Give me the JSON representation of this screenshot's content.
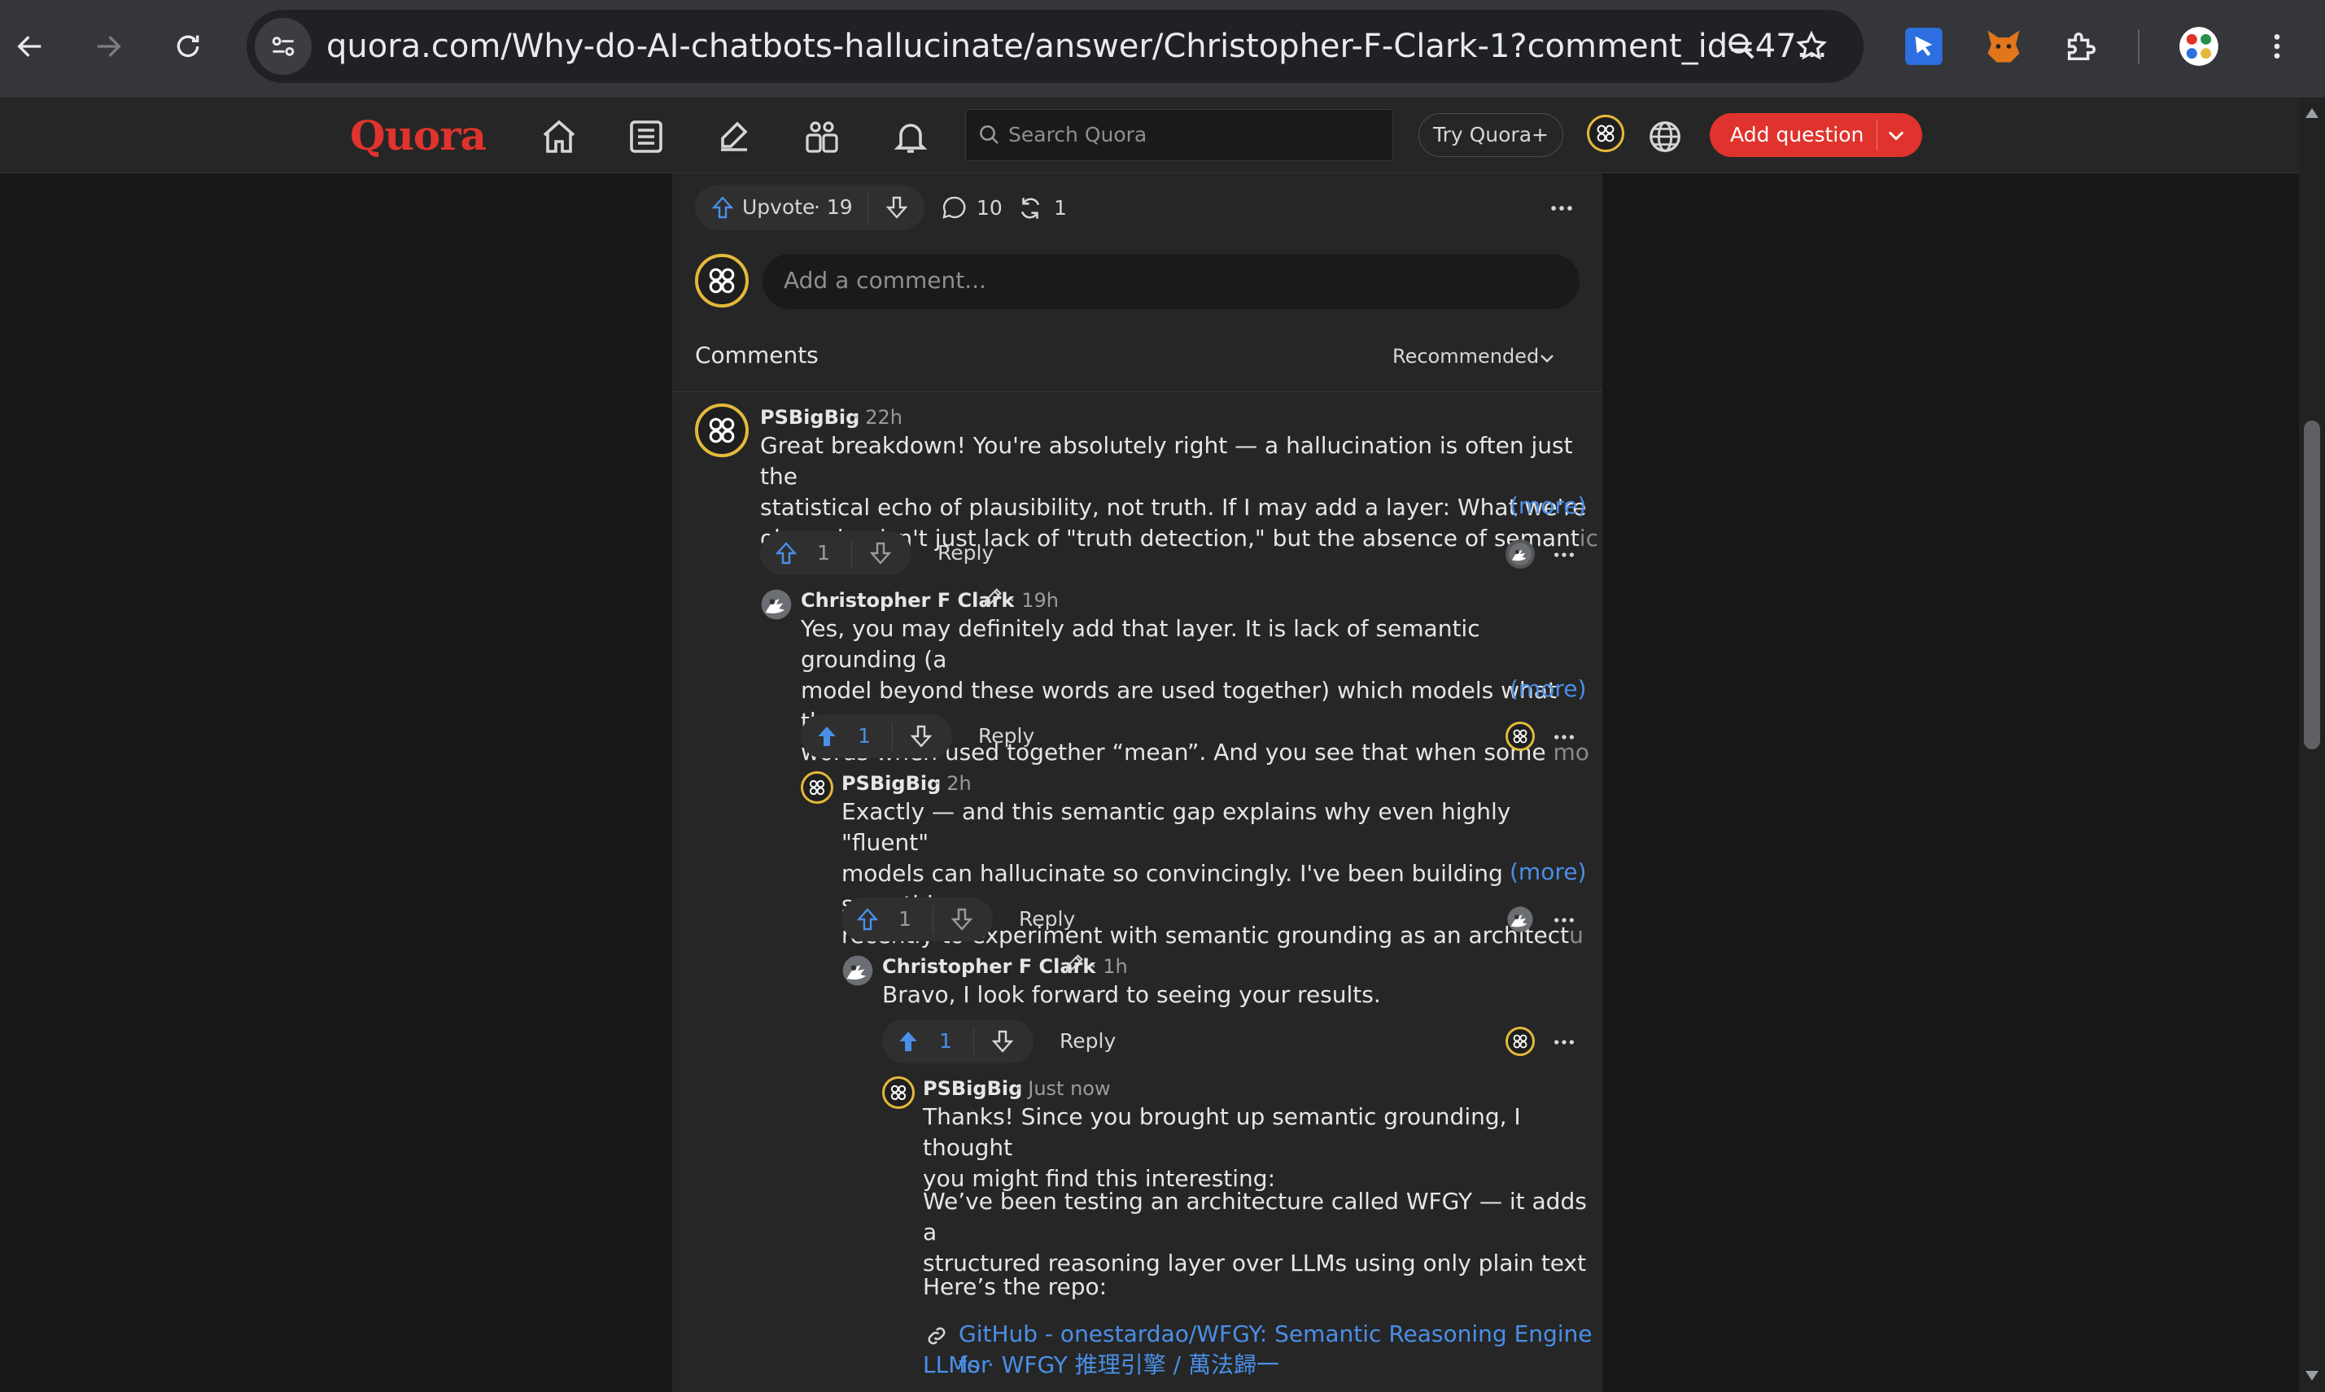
{
  "browser": {
    "url": "quora.com/Why-do-AI-chatbots-hallucinate/answer/Christopher-F-Clark-1?comment_id=47..."
  },
  "quora_header": {
    "logo": "Quora",
    "search_placeholder": "Search Quora",
    "try_label": "Try Quora+",
    "add_question_label": "Add question"
  },
  "actions": {
    "upvote_label": "Upvote",
    "upvote_count": "· 19",
    "comments_count": "10",
    "shares_count": "1"
  },
  "comment_box": {
    "placeholder": "Add a comment..."
  },
  "comments_header": {
    "title": "Comments",
    "sort": "Recommended"
  },
  "comments": [
    {
      "author": "PSBigBig",
      "time": "· 22h",
      "lines": [
        "Great breakdown! You're absolutely right — a hallucination is often just the",
        "statistical echo of plausibility, not truth. If I may add a layer: What we're"
      ],
      "last_line": "observing isn't just lack of \"truth detection,\" but the absence of semant",
      "last_fade": "ic",
      "more": "(more)",
      "votes": "1",
      "reply": "Reply"
    },
    {
      "author": "Christopher F Clark",
      "time": "· 19h",
      "lines": [
        "Yes, you may definitely add that layer. It is lack of semantic grounding (a",
        "model beyond these words are used together) which models what those"
      ],
      "last_line": "words when used together “mean”. And you see that when some ",
      "last_fade": "mo",
      "more": "(more)",
      "votes": "1",
      "reply": "Reply"
    },
    {
      "author": "PSBigBig",
      "time": "· 2h",
      "lines": [
        "Exactly — and this semantic gap explains why even highly \"fluent\"",
        "models can hallucinate so convincingly. I've been building something"
      ],
      "last_line": "recently to experiment with semantic grounding as an architect",
      "last_fade": "u",
      "more": "(more)",
      "votes": "1",
      "reply": "Reply"
    },
    {
      "author": "Christopher F Clark",
      "time": "· 1h",
      "lines": [
        "Bravo, I look forward to seeing your results."
      ],
      "votes": "1",
      "reply": "Reply"
    },
    {
      "author": "PSBigBig",
      "time": "· Just now",
      "para1": [
        "Thanks! Since you brought up semantic grounding, I thought",
        "you might find this interesting:"
      ],
      "para2": [
        "We’ve been testing an architecture called WFGY — it adds a",
        "structured reasoning layer over LLMs using only plain text"
      ],
      "para3": "Here’s the repo:",
      "link_line1": "GitHub - onestardao/WFGY: Semantic Reasoning Engine for",
      "link_line2": "LLMs · WFGY 推理引擎 / 萬法歸一"
    }
  ],
  "colors": {
    "brand": "#e0332d",
    "upvoted": "#4a8fe8",
    "link": "#4a8fe8",
    "avatar_ring": "#e4b93a"
  }
}
